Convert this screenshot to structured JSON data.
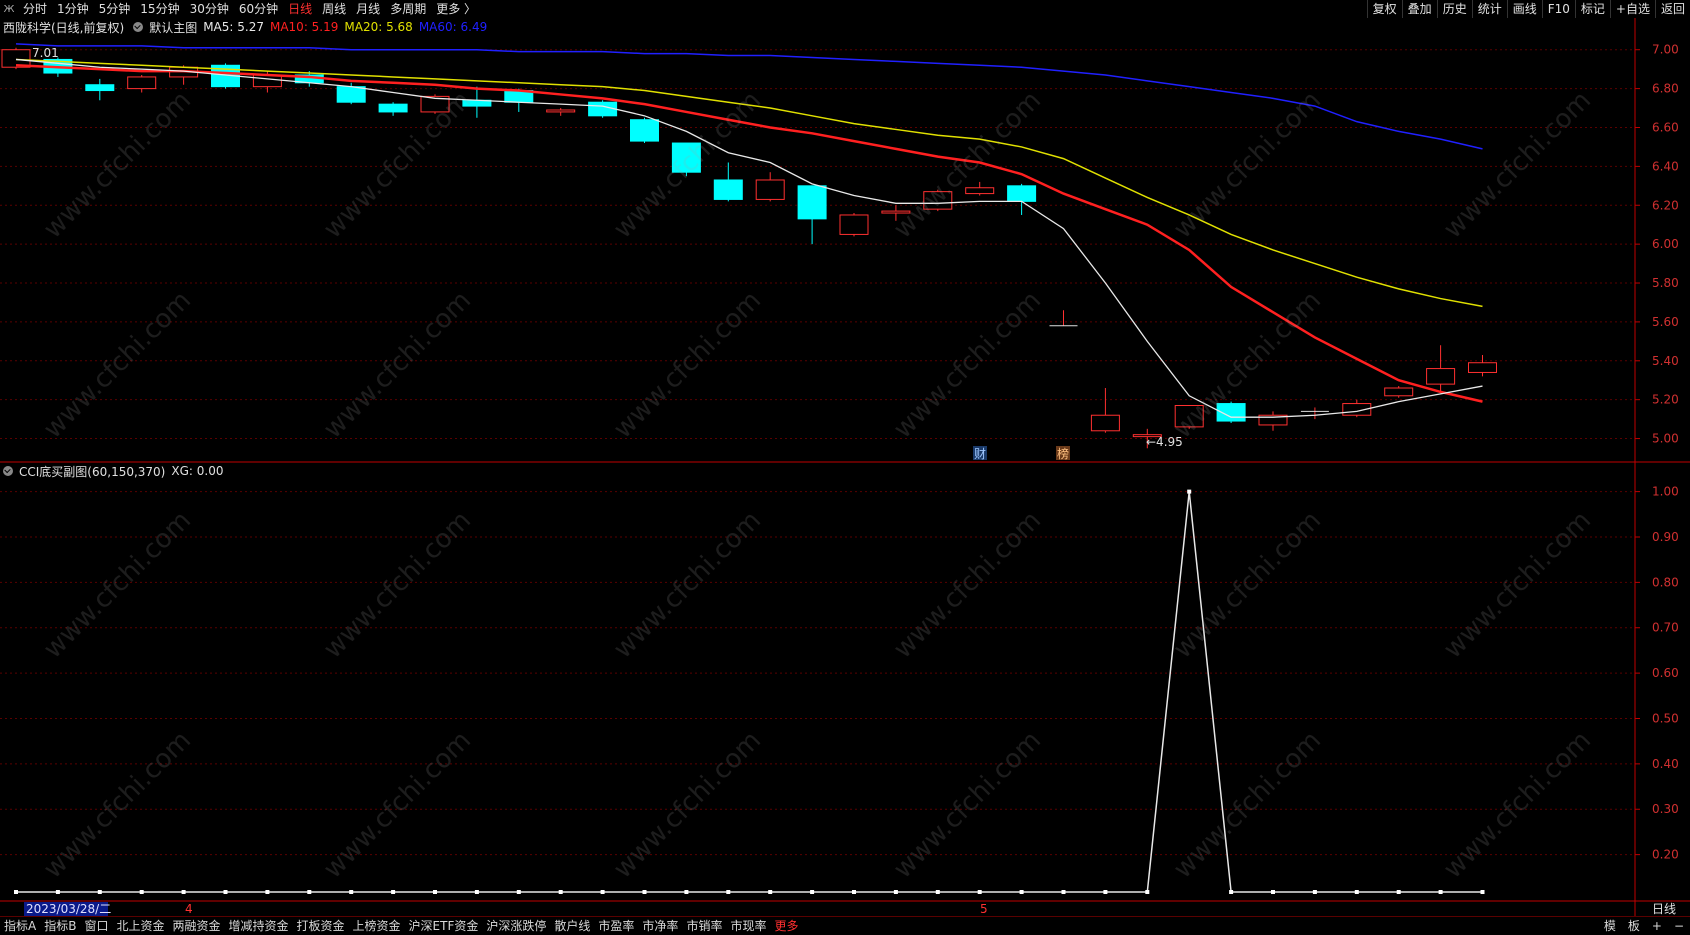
{
  "toolbar": {
    "logo": "Ж",
    "periods": [
      "分时",
      "1分钟",
      "5分钟",
      "15分钟",
      "30分钟",
      "60分钟",
      "日线",
      "周线",
      "月线",
      "多周期",
      "更多 〉"
    ],
    "active_period": "日线",
    "right_buttons": [
      "复权",
      "叠加",
      "历史",
      "统计",
      "画线",
      "F10",
      "标记",
      "+自选",
      "返回"
    ]
  },
  "main_info": {
    "stock": "西陇科学(日线,前复权)",
    "chart_name": "默认主图",
    "ma5": "MA5: 5.27",
    "ma10": "MA10: 5.19",
    "ma20": "MA20: 5.68",
    "ma60": "MA60: 6.49"
  },
  "sub_info": {
    "name": "CCI底买副图(60,150,370)",
    "xg": "XG: 0.00"
  },
  "markers": {
    "high_label": "7.01",
    "low_label": "←4.95",
    "cai": "财",
    "bang": "榜",
    "month4": "4",
    "month5": "5",
    "date_cursor": "2023/03/28/二"
  },
  "period_corner": "日线",
  "bottom_tabs": [
    "指标A",
    "指标B",
    "窗口",
    "北上资金",
    "两融资金",
    "增减持资金",
    "打板资金",
    "上榜资金",
    "沪深ETF资金",
    "沪深涨跌停",
    "散户线",
    "市盈率",
    "市净率",
    "市销率",
    "市现率",
    "更多"
  ],
  "bottom_right": [
    "模",
    "板",
    "+",
    "−"
  ],
  "watermark_text": "www.cfchi.com",
  "colors": {
    "up": "#ff3030",
    "down": "#00ffff",
    "ma5": "#e8e8e8",
    "ma10": "#ff2020",
    "ma20": "#e0e000",
    "ma60": "#2020ff",
    "axis": "#c00000"
  },
  "chart_data": [
    {
      "type": "candlestick",
      "title": "西陇科学(日线,前复权)",
      "ylim": [
        4.9,
        7.05
      ],
      "yticks": [
        7.0,
        6.8,
        6.6,
        6.4,
        6.2,
        6.0,
        5.8,
        5.6,
        5.4,
        5.2,
        5.0
      ],
      "candles": [
        {
          "o": 6.91,
          "h": 7.01,
          "l": 6.9,
          "c": 7.0
        },
        {
          "o": 6.95,
          "h": 6.96,
          "l": 6.86,
          "c": 6.88
        },
        {
          "o": 6.82,
          "h": 6.85,
          "l": 6.74,
          "c": 6.79
        },
        {
          "o": 6.8,
          "h": 6.87,
          "l": 6.78,
          "c": 6.86
        },
        {
          "o": 6.86,
          "h": 6.92,
          "l": 6.82,
          "c": 6.91
        },
        {
          "o": 6.92,
          "h": 6.93,
          "l": 6.8,
          "c": 6.81
        },
        {
          "o": 6.81,
          "h": 6.89,
          "l": 6.78,
          "c": 6.87
        },
        {
          "o": 6.87,
          "h": 6.89,
          "l": 6.81,
          "c": 6.83
        },
        {
          "o": 6.81,
          "h": 6.83,
          "l": 6.72,
          "c": 6.73
        },
        {
          "o": 6.72,
          "h": 6.73,
          "l": 6.66,
          "c": 6.68
        },
        {
          "o": 6.68,
          "h": 6.77,
          "l": 6.67,
          "c": 6.76
        },
        {
          "o": 6.74,
          "h": 6.81,
          "l": 6.65,
          "c": 6.71
        },
        {
          "o": 6.79,
          "h": 6.8,
          "l": 6.68,
          "c": 6.73
        },
        {
          "o": 6.68,
          "h": 6.7,
          "l": 6.66,
          "c": 6.69
        },
        {
          "o": 6.73,
          "h": 6.74,
          "l": 6.65,
          "c": 6.66
        },
        {
          "o": 6.64,
          "h": 6.65,
          "l": 6.52,
          "c": 6.53
        },
        {
          "o": 6.52,
          "h": 6.52,
          "l": 6.35,
          "c": 6.37
        },
        {
          "o": 6.33,
          "h": 6.42,
          "l": 6.22,
          "c": 6.23
        },
        {
          "o": 6.23,
          "h": 6.37,
          "l": 6.22,
          "c": 6.33
        },
        {
          "o": 6.3,
          "h": 6.3,
          "l": 6.0,
          "c": 6.13
        },
        {
          "o": 6.05,
          "h": 6.16,
          "l": 6.04,
          "c": 6.15
        },
        {
          "o": 6.16,
          "h": 6.2,
          "l": 6.12,
          "c": 6.17
        },
        {
          "o": 6.18,
          "h": 6.28,
          "l": 6.17,
          "c": 6.27
        },
        {
          "o": 6.26,
          "h": 6.32,
          "l": 6.25,
          "c": 6.29
        },
        {
          "o": 6.3,
          "h": 6.31,
          "l": 6.15,
          "c": 6.22
        },
        {
          "o": 5.58,
          "h": 5.66,
          "l": 5.58,
          "c": 5.58
        },
        {
          "o": 5.04,
          "h": 5.26,
          "l": 5.03,
          "c": 5.12
        },
        {
          "o": 5.01,
          "h": 5.05,
          "l": 4.95,
          "c": 5.02
        },
        {
          "o": 5.06,
          "h": 5.17,
          "l": 5.05,
          "c": 5.17
        },
        {
          "o": 5.18,
          "h": 5.19,
          "l": 5.08,
          "c": 5.09
        },
        {
          "o": 5.07,
          "h": 5.14,
          "l": 5.04,
          "c": 5.12
        },
        {
          "o": 5.14,
          "h": 5.16,
          "l": 5.1,
          "c": 5.14
        },
        {
          "o": 5.12,
          "h": 5.2,
          "l": 5.11,
          "c": 5.18
        },
        {
          "o": 5.22,
          "h": 5.27,
          "l": 5.21,
          "c": 5.26
        },
        {
          "o": 5.28,
          "h": 5.48,
          "l": 5.24,
          "c": 5.36
        },
        {
          "o": 5.34,
          "h": 5.43,
          "l": 5.32,
          "c": 5.39
        }
      ],
      "ma5": [
        6.95,
        6.93,
        6.91,
        6.9,
        6.89,
        6.87,
        6.85,
        6.83,
        6.81,
        6.78,
        6.75,
        6.74,
        6.73,
        6.72,
        6.71,
        6.66,
        6.58,
        6.47,
        6.42,
        6.31,
        6.25,
        6.21,
        6.21,
        6.22,
        6.22,
        6.08,
        5.8,
        5.5,
        5.22,
        5.11,
        5.11,
        5.12,
        5.14,
        5.19,
        5.23,
        5.27
      ],
      "ma10": [
        6.92,
        6.91,
        6.9,
        6.89,
        6.89,
        6.88,
        6.87,
        6.86,
        6.84,
        6.83,
        6.82,
        6.8,
        6.79,
        6.77,
        6.75,
        6.72,
        6.68,
        6.64,
        6.6,
        6.57,
        6.53,
        6.49,
        6.45,
        6.42,
        6.36,
        6.26,
        6.18,
        6.1,
        5.97,
        5.78,
        5.65,
        5.52,
        5.41,
        5.3,
        5.24,
        5.19
      ],
      "ma20": [
        6.95,
        6.94,
        6.93,
        6.92,
        6.91,
        6.9,
        6.89,
        6.88,
        6.87,
        6.86,
        6.85,
        6.84,
        6.83,
        6.82,
        6.81,
        6.79,
        6.76,
        6.73,
        6.7,
        6.66,
        6.62,
        6.59,
        6.56,
        6.54,
        6.5,
        6.44,
        6.34,
        6.24,
        6.15,
        6.05,
        5.97,
        5.9,
        5.83,
        5.77,
        5.72,
        5.68
      ],
      "ma60": [
        7.03,
        7.02,
        7.02,
        7.02,
        7.01,
        7.01,
        7.01,
        7.01,
        7.0,
        7.0,
        7.0,
        7.0,
        6.99,
        6.99,
        6.99,
        6.98,
        6.98,
        6.97,
        6.97,
        6.96,
        6.95,
        6.94,
        6.93,
        6.92,
        6.91,
        6.89,
        6.87,
        6.84,
        6.81,
        6.78,
        6.75,
        6.71,
        6.63,
        6.58,
        6.54,
        6.49
      ]
    },
    {
      "type": "line",
      "title": "CCI底买副图(60,150,370)",
      "ylim": [
        0.1,
        1.03
      ],
      "yticks": [
        1.0,
        0.9,
        0.8,
        0.7,
        0.6,
        0.5,
        0.4,
        0.3,
        0.2
      ],
      "series": [
        {
          "name": "XG",
          "values": [
            0,
            0,
            0,
            0,
            0,
            0,
            0,
            0,
            0,
            0,
            0,
            0,
            0,
            0,
            0,
            0,
            0,
            0,
            0,
            0,
            0,
            0,
            0,
            0,
            0,
            0,
            0,
            0,
            1,
            0,
            0,
            0,
            0,
            0,
            0,
            0
          ]
        }
      ]
    }
  ]
}
